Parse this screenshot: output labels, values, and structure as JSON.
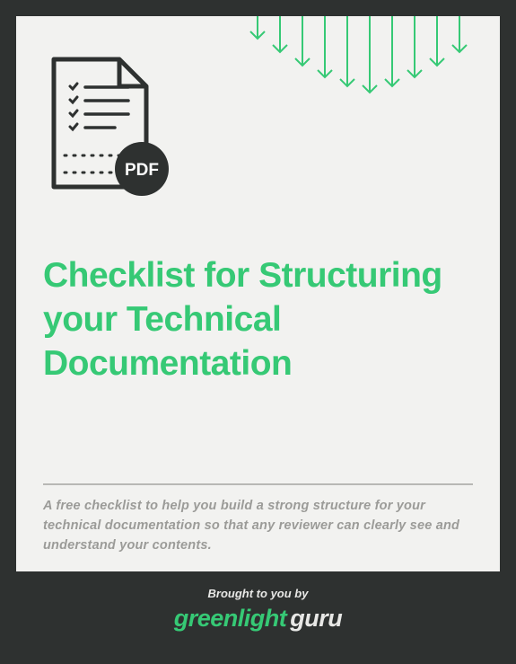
{
  "pdf_badge": "PDF",
  "title": "Checklist for Structuring your Technical Documentation",
  "subtitle": "A free checklist to help you build a strong structure for your technical documentation so that any reviewer can clearly see and understand your contents.",
  "footer": {
    "label": "Brought to you by",
    "logo_primary": "greenlight",
    "logo_secondary": "guru"
  }
}
